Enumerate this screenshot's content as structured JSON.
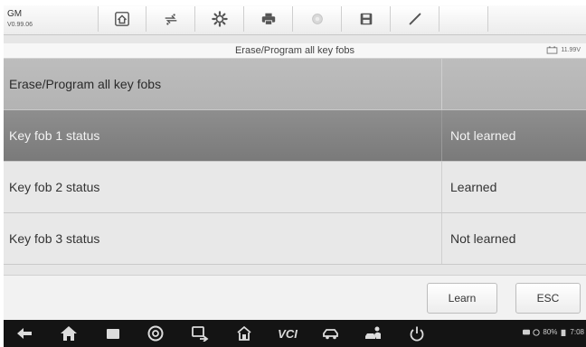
{
  "vehicle": {
    "make": "GM",
    "version": "V0.99.06"
  },
  "toolbar": {
    "icons": [
      "home-icon",
      "vehicle-swap-icon",
      "settings-icon",
      "print-icon",
      "help-icon",
      "save-icon",
      "pen-icon"
    ]
  },
  "page": {
    "title": "Erase/Program all key fobs",
    "voltage": "11.99V"
  },
  "table": {
    "header": {
      "label": "Erase/Program all key fobs",
      "value": ""
    },
    "rows": [
      {
        "label": "Key fob 1 status",
        "value": "Not learned",
        "selected": true
      },
      {
        "label": "Key fob 2 status",
        "value": "Learned",
        "selected": false
      },
      {
        "label": "Key fob 3 status",
        "value": "Not learned",
        "selected": false
      }
    ]
  },
  "actions": {
    "learn_label": "Learn",
    "esc_label": "ESC"
  },
  "navbar": {
    "icons": [
      "back-icon",
      "android-home-icon",
      "recent-apps-icon",
      "browser-icon",
      "screen-cast-icon",
      "autel-home-icon",
      "vci-icon",
      "car-icon",
      "user-car-icon",
      "power-icon"
    ],
    "vci_label": "VCI",
    "battery": "80%",
    "time": "7:08"
  },
  "colors": {
    "selected_row": "#848484",
    "header_row": "#b8b8b8",
    "navbar": "#141414"
  }
}
